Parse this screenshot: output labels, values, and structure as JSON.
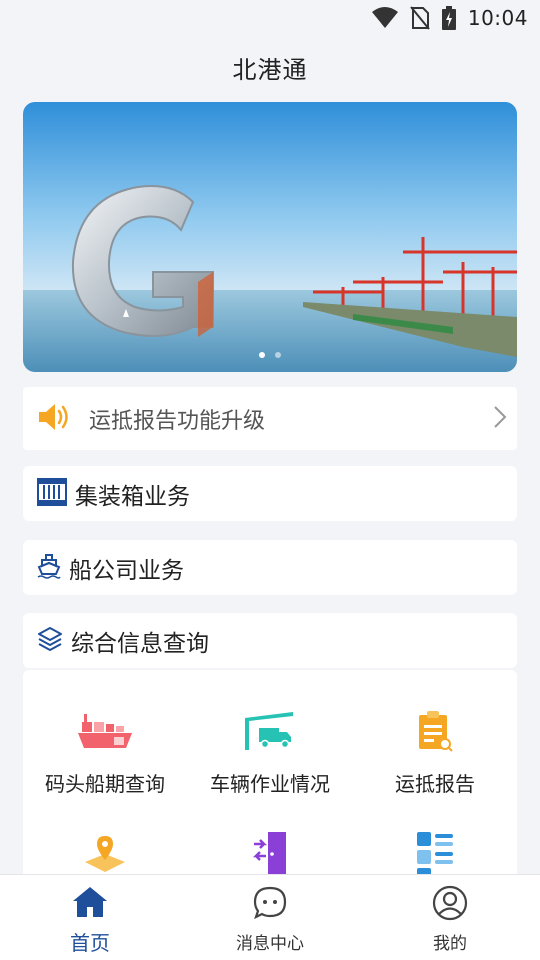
{
  "status_bar": {
    "time": "10:04"
  },
  "header": {
    "title": "北港通"
  },
  "banner": {
    "slide_count": 2,
    "active_index": 0
  },
  "notice": {
    "text": "运抵报告功能升级"
  },
  "sections": {
    "container": "集装箱业务",
    "shipping": "船公司业务",
    "info_query": "综合信息查询"
  },
  "grid": {
    "items": [
      {
        "label": "码头船期查询",
        "icon": "cargo-ship-icon",
        "color": "#f2626c"
      },
      {
        "label": "车辆作业情况",
        "icon": "truck-shed-icon",
        "color": "#26c2b4"
      },
      {
        "label": "运抵报告",
        "icon": "clipboard-report-icon",
        "color": "#f5a623"
      },
      {
        "label": "",
        "icon": "map-location-icon",
        "color": "#f5a623"
      },
      {
        "label": "",
        "icon": "door-exit-icon",
        "color": "#8a3fd6"
      },
      {
        "label": "",
        "icon": "list-grid-icon",
        "color": "#2a8fd8"
      }
    ]
  },
  "tabs": [
    {
      "label": "首页",
      "icon": "home-icon",
      "active": true
    },
    {
      "label": "消息中心",
      "icon": "message-icon",
      "active": false
    },
    {
      "label": "我的",
      "icon": "user-icon",
      "active": false
    }
  ],
  "colors": {
    "accent": "#1f4f9a",
    "background": "#f3f4f8"
  }
}
